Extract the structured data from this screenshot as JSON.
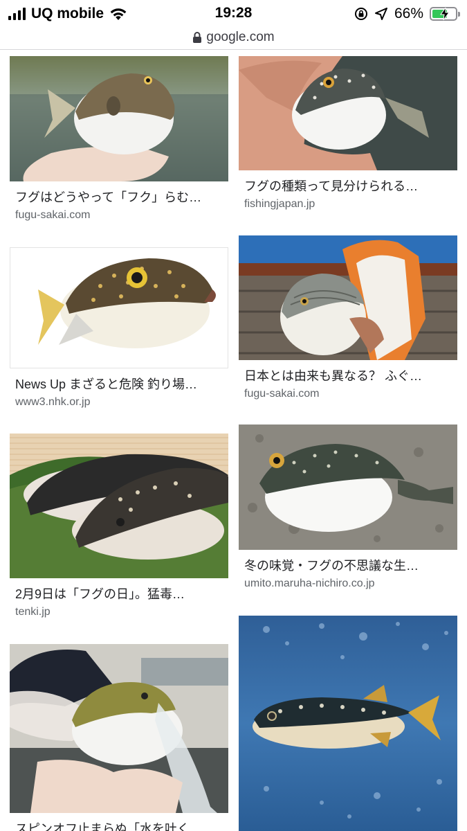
{
  "status_bar": {
    "carrier": "UQ mobile",
    "time": "19:28",
    "battery_percent": "66%"
  },
  "browser": {
    "url": "google.com"
  },
  "results": [
    {
      "title": "フグはどうやって「フク」らむ…",
      "source": "fugu-sakai.com"
    },
    {
      "title": "フグの種類って見分けられる…",
      "source": "fishingjapan.jp"
    },
    {
      "title": "News Up まざると危険 釣り場…",
      "source": "www3.nhk.or.jp"
    },
    {
      "title": "日本とは由来も異なる？ ふぐ…",
      "source": "fugu-sakai.com"
    },
    {
      "title": "2月9日は「フグの日」。猛毒…",
      "source": "tenki.jp"
    },
    {
      "title": "冬の味覚・フグの不思議な生…",
      "source": "umito.maruha-nichiro.co.jp"
    },
    {
      "title": "スピンオフ止まらぬ「水を吐く…",
      "source": ""
    }
  ],
  "colors": {
    "battery_green": "#34c759",
    "source_gray": "#5f6368"
  }
}
